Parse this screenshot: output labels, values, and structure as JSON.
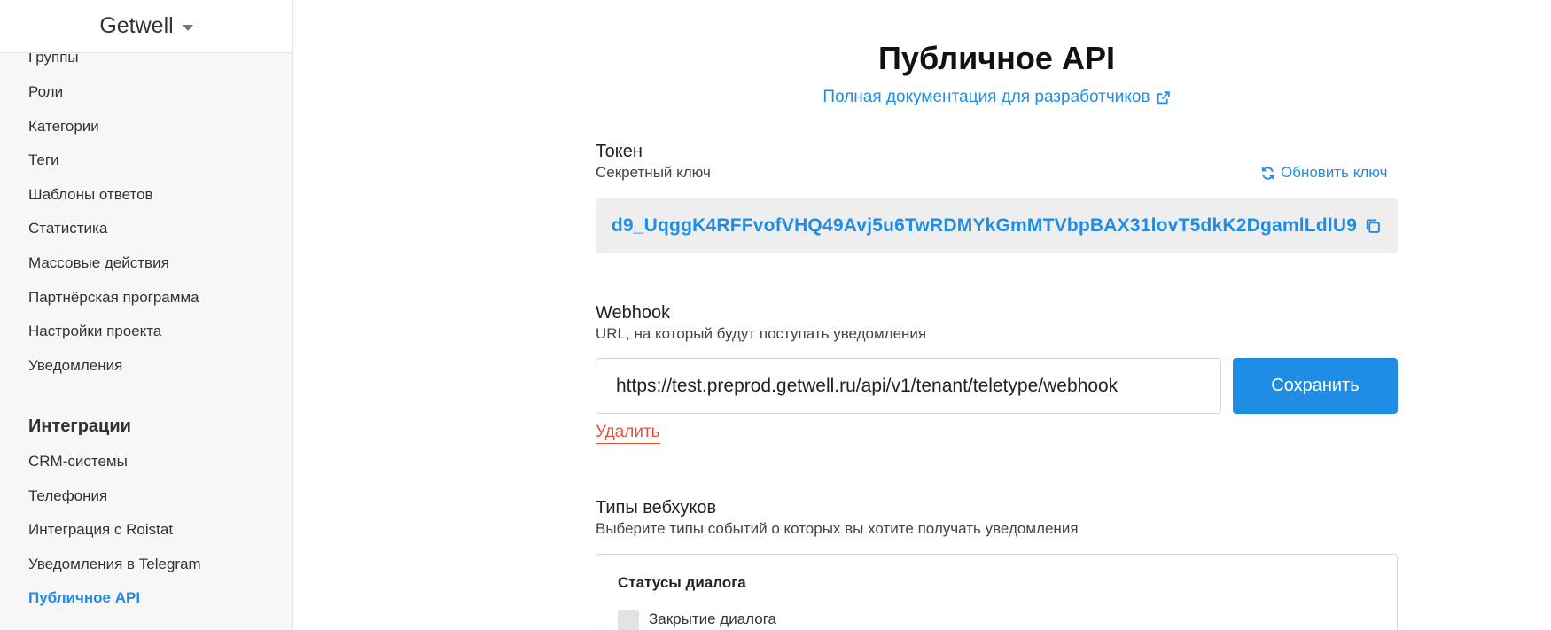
{
  "sidebar": {
    "brand": "Getwell",
    "items_top": [
      "Группы",
      "Роли",
      "Категории",
      "Теги",
      "Шаблоны ответов",
      "Статистика",
      "Массовые действия",
      "Партнёрская программа",
      "Настройки проекта",
      "Уведомления"
    ],
    "integrations_title": "Интеграции",
    "items_integrations": [
      "CRM-системы",
      "Телефония",
      "Интеграция с Roistat",
      "Уведомления в Telegram",
      "Публичное API"
    ]
  },
  "main": {
    "title": "Публичное API",
    "doc_link": "Полная документация для разработчиков",
    "token": {
      "title": "Токен",
      "subtitle": "Секретный ключ",
      "refresh_label": "Обновить ключ",
      "value": "d9_UqggK4RFFvofVHQ49Avj5u6TwRDMYkGmMTVbpBAX31lovT5dkK2DgamlLdlU9"
    },
    "webhook": {
      "title": "Webhook",
      "subtitle": "URL, на который будут поступать уведомления",
      "url_value": "https://test.preprod.getwell.ru/api/v1/tenant/teletype/webhook",
      "save_label": "Сохранить",
      "delete_label": "Удалить"
    },
    "webhook_types": {
      "title": "Типы вебхуков",
      "subtitle": "Выберите типы событий о которых вы хотите получать уведомления",
      "group_title": "Статусы диалога",
      "option_label": "Закрытие диалога"
    }
  },
  "colors": {
    "accent": "#1f8de6",
    "danger": "#e0543d",
    "sidebar_bg": "#f7f7f8"
  }
}
